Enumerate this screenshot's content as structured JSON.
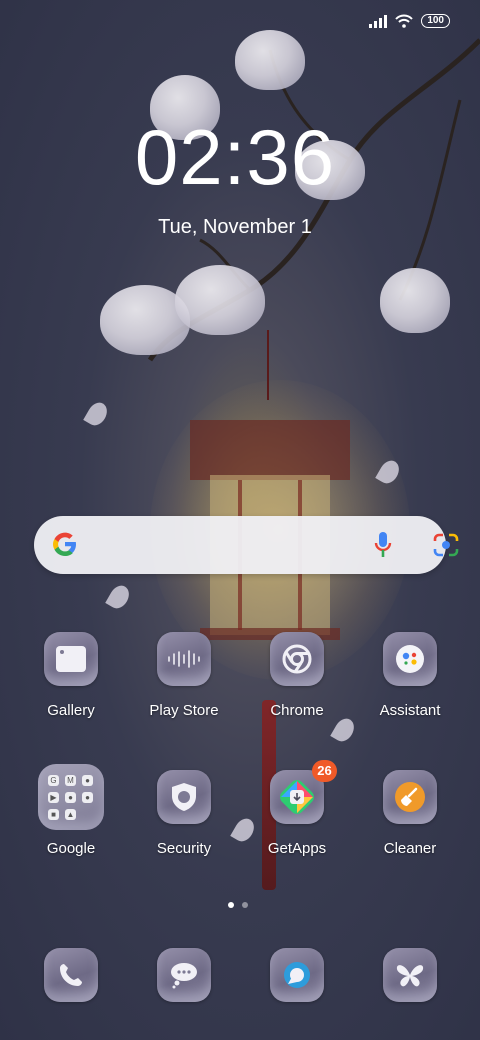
{
  "status_bar": {
    "battery": "100"
  },
  "lock": {
    "time": "02:36",
    "date": "Tue, November 1"
  },
  "search_widget": {
    "icons": [
      "google-g-icon",
      "microphone-icon",
      "google-lens-icon"
    ]
  },
  "apps_row1": [
    {
      "label": "Gallery",
      "icon": "gallery-icon"
    },
    {
      "label": "Play Store",
      "icon": "sound-bars-icon"
    },
    {
      "label": "Chrome",
      "icon": "chrome-icon"
    },
    {
      "label": "Assistant",
      "icon": "assistant-icon"
    }
  ],
  "apps_row2": [
    {
      "label": "Google",
      "icon": "google-folder-icon"
    },
    {
      "label": "Security",
      "icon": "shield-icon"
    },
    {
      "label": "GetApps",
      "icon": "getapps-icon",
      "badge": "26"
    },
    {
      "label": "Cleaner",
      "icon": "broom-icon"
    }
  ],
  "dock": [
    {
      "icon": "phone-icon"
    },
    {
      "icon": "messages-icon"
    },
    {
      "icon": "browser-icon"
    },
    {
      "icon": "butterfly-icon"
    }
  ],
  "page_indicator": {
    "pages": 2,
    "current": 1
  },
  "colors": {
    "badge": "#f05a28",
    "search_bg": "#f0f0f4",
    "wallpaper": "#2f3247"
  }
}
